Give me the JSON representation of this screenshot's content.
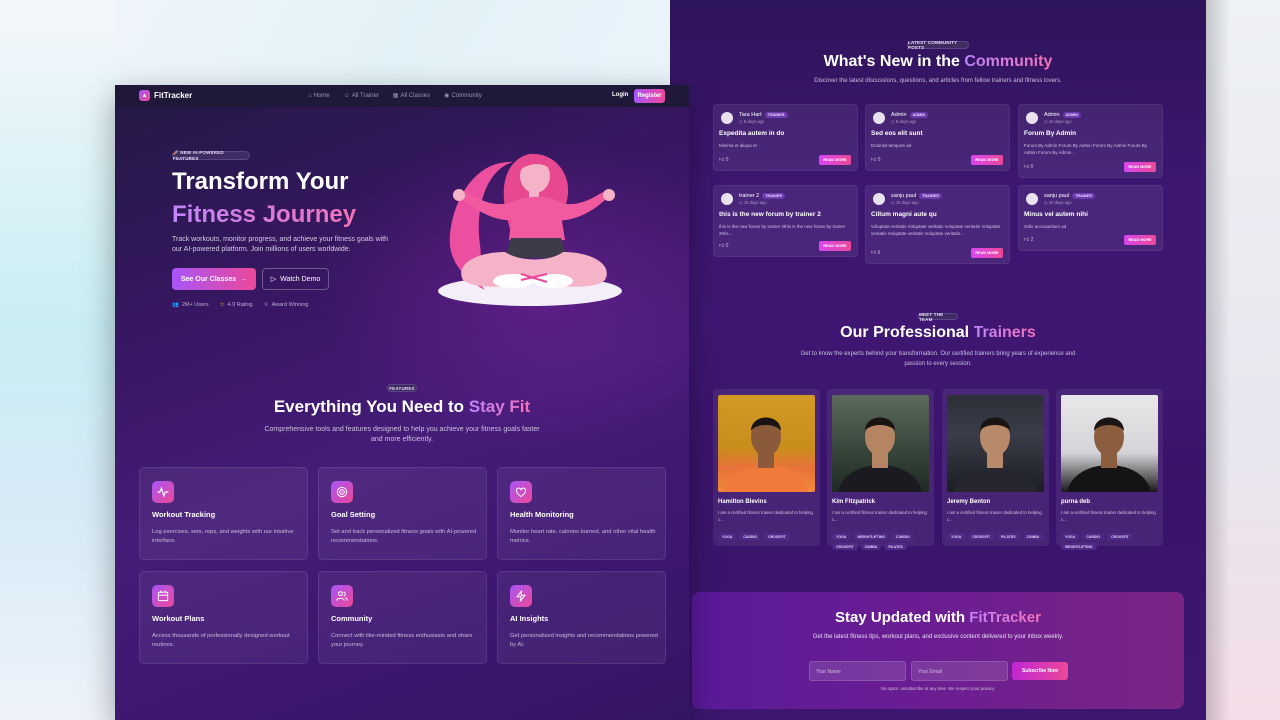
{
  "nav": {
    "brand": "FitTracker",
    "links": [
      "Home",
      "All Trainer",
      "All Classes",
      "Community"
    ],
    "login": "Login",
    "register": "Register"
  },
  "hero": {
    "badge": "🚀 NEW AI-POWERED FEATURES",
    "title_line1": "Transform Your",
    "title_line2": "Fitness Journey",
    "subtitle": "Track workouts, monitor progress, and achieve your fitness goals with our AI-powered platform. Join millions of users worldwide.",
    "primary_button": "See Our Classes",
    "secondary_button": "Watch Demo",
    "stats": [
      "2M+ Users",
      "4.9 Rating",
      "Award Winning"
    ]
  },
  "features": {
    "badge": "FEATURES",
    "title_plain": "Everything You Need to ",
    "title_accent": "Stay Fit",
    "subtitle": "Comprehensive tools and features designed to help you achieve your fitness goals faster and more efficiently.",
    "items": [
      {
        "icon": "activity-icon",
        "title": "Workout Tracking",
        "desc": "Log exercises, sets, reps, and weights with our intuitive interface."
      },
      {
        "icon": "target-icon",
        "title": "Goal Setting",
        "desc": "Set and track personalized fitness goals with AI-powered recommendations."
      },
      {
        "icon": "heart-icon",
        "title": "Health Monitoring",
        "desc": "Monitor heart rate, calories burned, and other vital health metrics."
      },
      {
        "icon": "calendar-icon",
        "title": "Workout Plans",
        "desc": "Access thousands of professionally designed workout routines."
      },
      {
        "icon": "users-icon",
        "title": "Community",
        "desc": "Connect with like-minded fitness enthusiasts and share your journey."
      },
      {
        "icon": "lightning-icon",
        "title": "AI Insights",
        "desc": "Get personalized insights and recommendations powered by AI."
      }
    ]
  },
  "community": {
    "badge": "LATEST COMMUNITY POSTS",
    "title_plain": "What's New in the ",
    "title_accent": "Community",
    "subtitle": "Discover the latest discussions, questions, and articles from fellow trainers and fitness lovers.",
    "posts": [
      {
        "author": "Tara Hart",
        "role": "TRAINER",
        "time": "8 days ago",
        "title": "Expedita autem in do",
        "body": "Minima et aliqua et",
        "likes": "0",
        "cta": "READ MORE"
      },
      {
        "author": "Admin",
        "role": "ADMIN",
        "time": "8 days ago",
        "title": "Sed eos elit sunt",
        "body": "Dolorisit tempore ad",
        "likes": "0",
        "cta": "READ MORE"
      },
      {
        "author": "Admin",
        "role": "ADMIN",
        "time": "10 days ago",
        "title": "Forum By Admin",
        "body": "Forum By Admin Forum By Admin Forum By Admin Forum By Admin Forum By Admin...",
        "likes": "0",
        "cta": "READ MORE"
      },
      {
        "author": "trainer 2",
        "role": "TRAINER",
        "time": "10 days ago",
        "title": "this is the new forum by trainer 2",
        "body": "this is the new forum by trainer 2this is the new forum by trainer 2this...",
        "likes": "0",
        "cta": "READ MORE"
      },
      {
        "author": "sanju paul",
        "role": "TRAINER",
        "time": "10 days ago",
        "title": "Cillum magni aute qu",
        "body": "Voluptate veritatis Voluptate veritatis Voluptate veritatis Voluptate veritatis Voluptate veritatis Voluptate veritatis...",
        "likes": "6",
        "cta": "READ MORE"
      },
      {
        "author": "sanju paul",
        "role": "TRAINER",
        "time": "10 days ago",
        "title": "Minus vel autem nihi",
        "body": "Odio accusantium ad",
        "likes": "2",
        "cta": "READ MORE"
      }
    ]
  },
  "trainers": {
    "badge": "MEET THE TEAM",
    "title_plain": "Our Professional ",
    "title_accent": "Trainers",
    "subtitle": "Get to know the experts behind your transformation. Our certified trainers bring years of experience and passion to every session.",
    "items": [
      {
        "name": "Hamilton Blevins",
        "bio": "I am a certified fitness trainer dedicated to helping c...",
        "tags": [
          "YOGA",
          "CARDIO",
          "CROSSFIT"
        ]
      },
      {
        "name": "Kim Fitzpatrick",
        "bio": "I am a certified fitness trainer dedicated to helping c...",
        "tags": [
          "YOGA",
          "WEIGHTLIFTING",
          "CARDIO",
          "CROSSFIT",
          "ZUMBA",
          "PILATES"
        ]
      },
      {
        "name": "Jeremy Benton",
        "bio": "I am a certified fitness trainer dedicated to helping c...",
        "tags": [
          "YOGA",
          "CROSSFIT",
          "PILATES",
          "ZUMBA"
        ]
      },
      {
        "name": "purna deb",
        "bio": "I am a certified fitness trainer dedicated to helping c...",
        "tags": [
          "YOGA",
          "CARDIO",
          "CROSSFIT",
          "WEIGHTLIFTING"
        ]
      }
    ]
  },
  "newsletter": {
    "title_plain": "Stay Updated with ",
    "title_accent": "FitTracker",
    "subtitle": "Get the latest fitness tips, workout plans, and exclusive content delivered to your inbox weekly.",
    "name_placeholder": "Your Name",
    "email_placeholder": "Your Email",
    "button": "Subscribe Now",
    "fine_print": "No spam, unsubscribe at any time. We respect your privacy."
  }
}
